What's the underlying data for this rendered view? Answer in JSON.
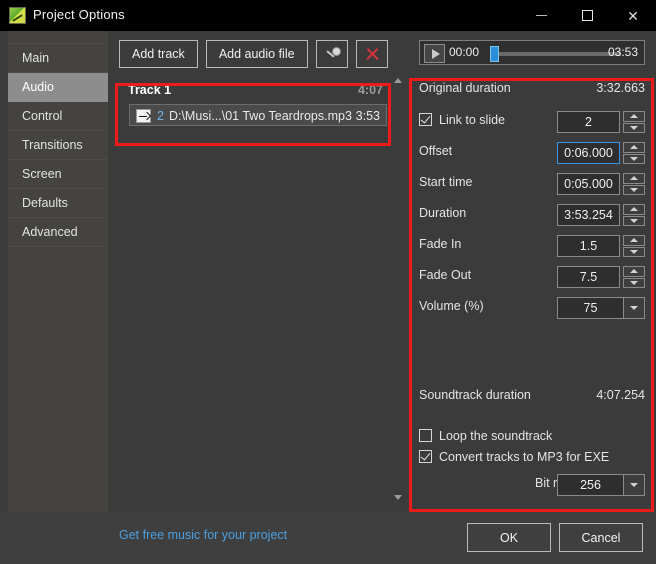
{
  "window": {
    "title": "Project Options",
    "icon": "app-icon",
    "controls": {
      "minimize": "minimize",
      "maximize": "maximize",
      "close": "close"
    }
  },
  "sidebar": {
    "items": [
      {
        "label": "Main",
        "selected": false
      },
      {
        "label": "Audio",
        "selected": true
      },
      {
        "label": "Control",
        "selected": false
      },
      {
        "label": "Transitions",
        "selected": false
      },
      {
        "label": "Screen",
        "selected": false
      },
      {
        "label": "Defaults",
        "selected": false
      },
      {
        "label": "Advanced",
        "selected": false
      }
    ]
  },
  "toolbar": {
    "add_track": "Add track",
    "add_audio_file": "Add audio file",
    "record_icon": "microphone-icon",
    "delete_icon": "delete-x-icon"
  },
  "tracklist": {
    "track": {
      "name": "Track 1",
      "duration": "4:07"
    },
    "files": [
      {
        "index": "2",
        "path": "D:\\Musi...\\01 Two Teardrops.mp3",
        "duration": "3:53"
      }
    ]
  },
  "player": {
    "play_icon": "play-icon",
    "current_time": "00:00",
    "total_time": "03:53",
    "position_percent": 0
  },
  "properties": {
    "original_duration": {
      "label": "Original duration",
      "value": "3:32.663"
    },
    "link_to_slide": {
      "label": "Link to slide",
      "checked": true,
      "value": "2"
    },
    "offset": {
      "label": "Offset",
      "value": "0:06.000",
      "focused": true
    },
    "start_time": {
      "label": "Start time",
      "value": "0:05.000"
    },
    "duration": {
      "label": "Duration",
      "value": "3:53.254"
    },
    "fade_in": {
      "label": "Fade In",
      "value": "1.5"
    },
    "fade_out": {
      "label": "Fade Out",
      "value": "7.5"
    },
    "volume": {
      "label": "Volume (%)",
      "value": "75"
    },
    "soundtrack_duration": {
      "label": "Soundtrack duration",
      "value": "4:07.254"
    },
    "loop_soundtrack": {
      "label": "Loop the soundtrack",
      "checked": false
    },
    "convert_mp3": {
      "label": "Convert tracks to MP3 for EXE",
      "checked": true
    },
    "bit_rate": {
      "label": "Bit rate",
      "value": "256"
    }
  },
  "footer": {
    "free_music_link": "Get free music for your project",
    "ok": "OK",
    "cancel": "Cancel"
  },
  "colors": {
    "accent_blue": "#3b93e0",
    "link_blue": "#4b9fe0",
    "annotation_red": "#ef1b1b",
    "selection_gray": "#8d8d8d",
    "panel_bg": "#3b3b3b"
  }
}
